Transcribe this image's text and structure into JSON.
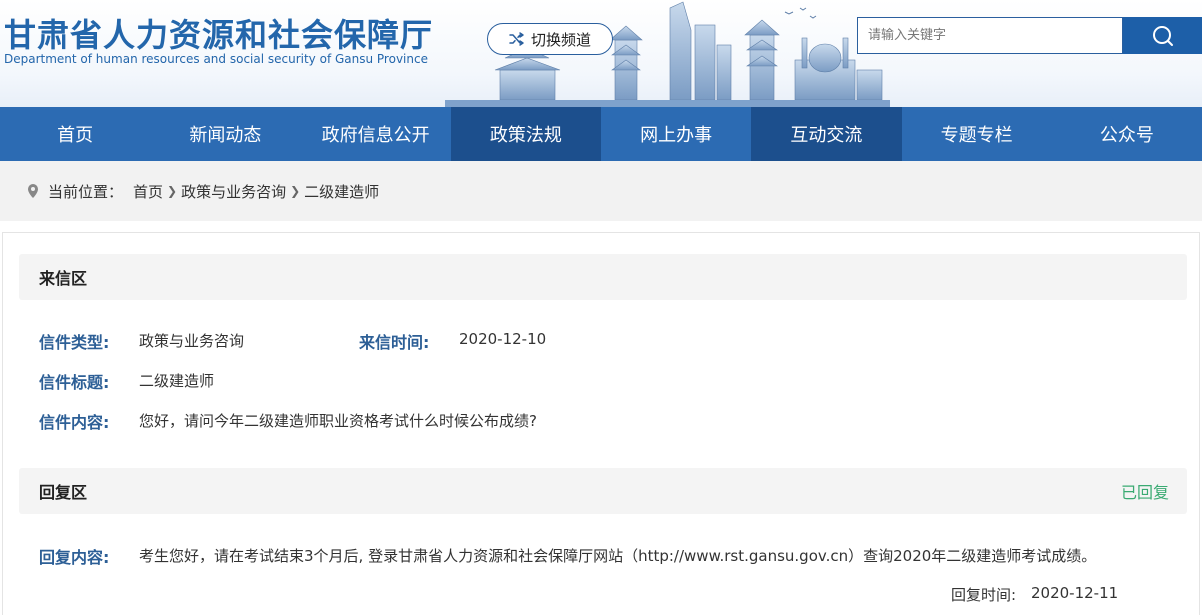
{
  "header": {
    "title_cn": "甘肃省人力资源和社会保障厅",
    "title_en": "Department of human resources and social security of Gansu Province",
    "switch_label": "切换频道",
    "search_placeholder": "请输入关键字"
  },
  "nav": {
    "items": [
      "首页",
      "新闻动态",
      "政府信息公开",
      "政策法规",
      "网上办事",
      "互动交流",
      "专题专栏",
      "公众号"
    ],
    "active_indices": [
      3,
      5
    ]
  },
  "breadcrumb": {
    "prefix": "当前位置：",
    "items": [
      "首页",
      "政策与业务咨询",
      "二级建造师"
    ]
  },
  "letter": {
    "section_title": "来信区",
    "type_label": "信件类型:",
    "type_value": "政策与业务咨询",
    "time_label": "来信时间:",
    "time_value": "2020-12-10",
    "title_label": "信件标题:",
    "title_value": "二级建造师",
    "content_label": "信件内容:",
    "content_value": "您好，请问今年二级建造师职业资格考试什么时候公布成绩?"
  },
  "reply": {
    "section_title": "回复区",
    "status": "已回复",
    "content_label": "回复内容:",
    "content_value": "考生您好，请在考试结束3个月后, 登录甘肃省人力资源和社会保障厅网站（http://www.rst.gansu.gov.cn）查询2020年二级建造师考试成绩。",
    "time_label": "回复时间:",
    "time_value": "2020-12-11"
  },
  "colors": {
    "brand_blue": "#2366ab",
    "nav_bg": "#2c6bb3",
    "nav_active": "#1c4f8d",
    "label_blue": "#2d5f96",
    "status_green": "#3aaa72"
  }
}
